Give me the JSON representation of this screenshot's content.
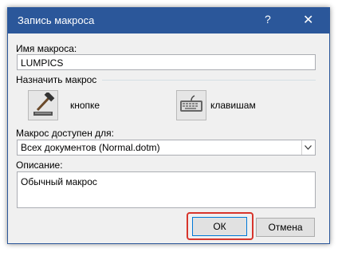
{
  "dialog": {
    "title": "Запись макроса",
    "help_glyph": "?",
    "close_glyph": "✕",
    "macro_name_label": "Имя макроса:",
    "macro_name_value": "LUMPICS",
    "assign_label": "Назначить макрос",
    "button_option_label": "кнопке",
    "keys_option_label": "клавишам",
    "available_label": "Макрос доступен для:",
    "available_value": "Всех документов (Normal.dotm)",
    "description_label": "Описание:",
    "description_value": "Обычный макрос",
    "ok_label": "ОК",
    "cancel_label": "Отмена"
  },
  "colors": {
    "title_bar": "#2b579a",
    "highlight": "#d7352c"
  }
}
